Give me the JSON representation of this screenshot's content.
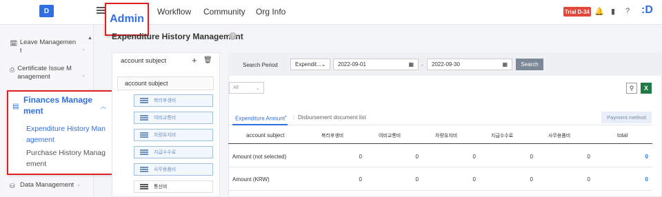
{
  "header": {
    "logo_letter": "D",
    "nav": [
      "Admin",
      "Workflow",
      "Community",
      "Org Info"
    ],
    "trial_badge": "Trial D-34",
    "brand": ":D"
  },
  "sidebar": {
    "items": [
      {
        "label": "Leave Managemen t",
        "icon": "calendar-icon"
      },
      {
        "label": "Certificate Issue M anagement",
        "icon": "certificate-icon"
      },
      {
        "label": "Data Management",
        "icon": "database-icon"
      }
    ],
    "finances": {
      "title": "Finances Manage ment",
      "subitems": [
        "Expenditure History Man agement",
        "Purchase History Manag ement"
      ]
    }
  },
  "page": {
    "title": "Expenditure History Management"
  },
  "account_panel": {
    "title": "account subject",
    "root": "account subject",
    "chips": [
      "복리후생비",
      "여비교통비",
      "차량유지비",
      "지급수수료",
      "사무용품비",
      "통신비"
    ]
  },
  "search": {
    "period_label": "Search Period",
    "type_select": "Expendit...",
    "date_from": "2022-09-01",
    "date_to": "2022-09-30",
    "separator": "-",
    "button": "Search",
    "filter_all": "All"
  },
  "tabs": {
    "active": "Expenditure Amount",
    "inactive": "Disbursement document list",
    "payment_button": "Payment method"
  },
  "table": {
    "headers": [
      "account subject",
      "복리후생비",
      "여비교통비",
      "차량유지비",
      "지급수수료",
      "사무용품비",
      "total"
    ],
    "rows": [
      {
        "label": "Amount (not selected)",
        "values": [
          "0",
          "0",
          "0",
          "0",
          "0",
          "0"
        ]
      },
      {
        "label": "Amount (KRW)",
        "values": [
          "0",
          "0",
          "0",
          "0",
          "0",
          "0"
        ]
      }
    ]
  }
}
